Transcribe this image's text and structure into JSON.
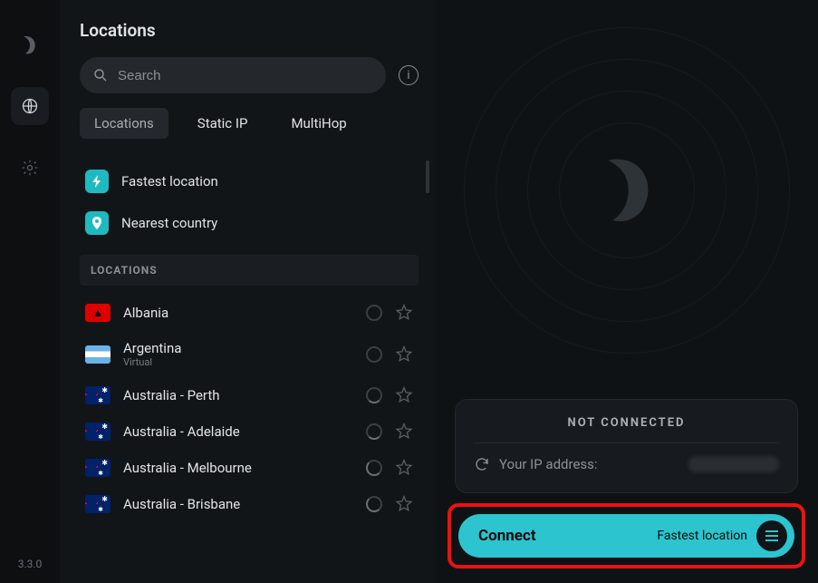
{
  "rail": {
    "version": "3.3.0"
  },
  "panel": {
    "title": "Locations",
    "search_placeholder": "Search",
    "tabs": [
      {
        "label": "Locations",
        "active": true
      },
      {
        "label": "Static IP",
        "active": false
      },
      {
        "label": "MultiHop",
        "active": false
      }
    ],
    "quick": [
      {
        "icon": "bolt",
        "label": "Fastest location"
      },
      {
        "icon": "pin",
        "label": "Nearest country"
      }
    ],
    "section_header": "LOCATIONS",
    "locations": [
      {
        "name": "Albania",
        "sub": "",
        "flag": "al",
        "load": "none"
      },
      {
        "name": "Argentina",
        "sub": "Virtual",
        "flag": "ar",
        "load": "none"
      },
      {
        "name": "Australia - Perth",
        "sub": "",
        "flag": "au",
        "load": "q1"
      },
      {
        "name": "Australia - Adelaide",
        "sub": "",
        "flag": "au",
        "load": "q1"
      },
      {
        "name": "Australia - Melbourne",
        "sub": "",
        "flag": "au",
        "load": "half"
      },
      {
        "name": "Australia - Brisbane",
        "sub": "",
        "flag": "au",
        "load": "half"
      }
    ]
  },
  "status": {
    "title": "NOT CONNECTED",
    "ip_label": "Your IP address:"
  },
  "connect": {
    "label": "Connect",
    "sub": "Fastest location"
  }
}
